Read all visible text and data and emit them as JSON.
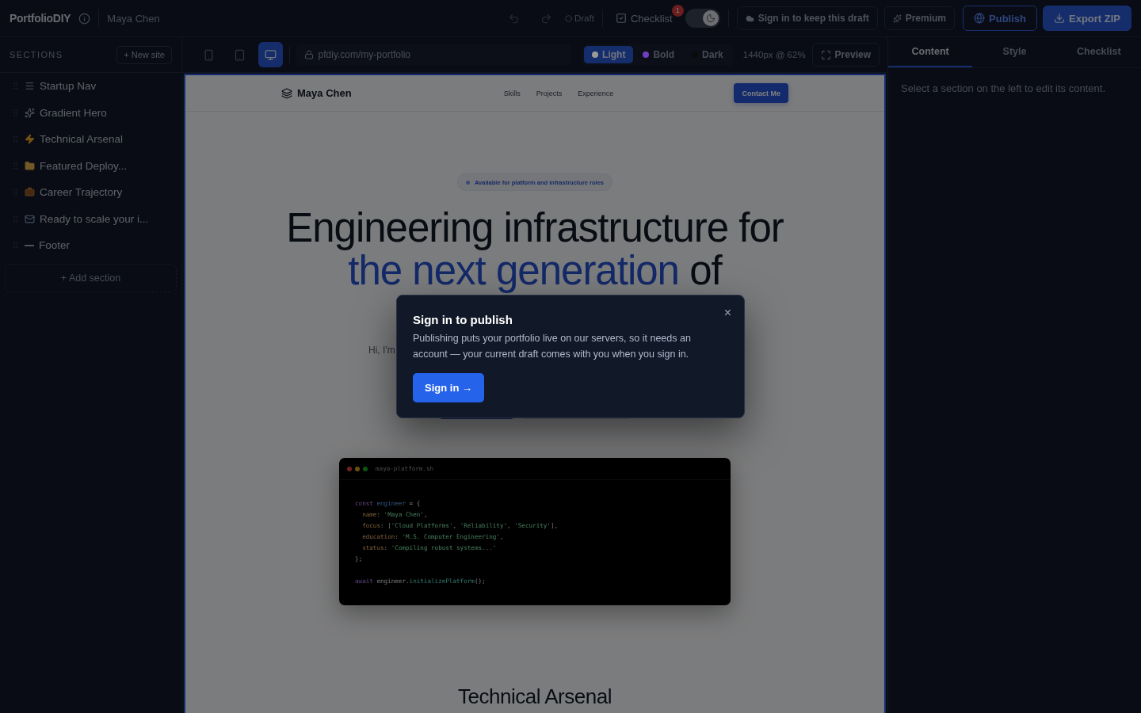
{
  "topbar": {
    "brand": "PortfolioDIY",
    "site_name": "Maya Chen",
    "draft": "Draft",
    "checklist": {
      "label": "Checklist",
      "badge": "1"
    },
    "dark_mode": {
      "on": true
    },
    "sign_in_prompt": "Sign in to keep this draft",
    "premium": "Premium",
    "publish": "Publish",
    "export": "Export ZIP"
  },
  "sidebar": {
    "heading": "SECTIONS",
    "new_site": "+ New site",
    "sections": [
      {
        "label": "Startup Nav",
        "kind": "menu"
      },
      {
        "label": "Gradient Hero",
        "kind": "sparkle"
      },
      {
        "label": "Technical Arsenal",
        "kind": "bolt"
      },
      {
        "label": "Featured Deploy...",
        "kind": "folder"
      },
      {
        "label": "Career Trajectory",
        "kind": "briefcase"
      },
      {
        "label": "Ready to scale your i...",
        "kind": "mail"
      },
      {
        "label": "Footer",
        "kind": "line"
      }
    ],
    "add_section": "+ Add section"
  },
  "canvas_toolbar": {
    "devices": [
      {
        "kind": "phone",
        "selected": false
      },
      {
        "kind": "tablet",
        "selected": false
      },
      {
        "kind": "desktop",
        "selected": true
      }
    ],
    "url": "pfdiy.com/my-portfolio",
    "themes": [
      {
        "label": "Light",
        "color": "#9a9a9a",
        "selected": true
      },
      {
        "label": "Bold",
        "color": "#6d3fc0",
        "selected": false
      },
      {
        "label": "Dark",
        "color": "#0b0b0b",
        "selected": false
      }
    ],
    "viewport": "1440px @ 62%",
    "preview": "Preview"
  },
  "preview": {
    "nav": {
      "brand": "Maya Chen",
      "links": [
        "Skills",
        "Projects",
        "Experience"
      ],
      "cta": "Contact Me"
    },
    "hero": {
      "badge": "Available for platform and infrastructure roles",
      "title_line": "Engineering infrastructure for",
      "title_highlight": "the next generation",
      "title_rest": "of",
      "intro": "Hi, I'm"
    },
    "code_window": {
      "filename": "maya-platform.sh",
      "lines": [
        [
          {
            "text": "const",
            "kind": "keyword"
          },
          {
            "text": " engineer",
            "kind": "var"
          },
          {
            "text": " = {",
            "kind": "punct"
          }
        ],
        [
          {
            "text": "  name",
            "kind": "prop"
          },
          {
            "text": ": ",
            "kind": "punct"
          },
          {
            "text": "'Maya Chen'",
            "kind": "string"
          },
          {
            "text": ",",
            "kind": "punct"
          }
        ],
        [
          {
            "text": "  focus",
            "kind": "prop"
          },
          {
            "text": ": [",
            "kind": "punct"
          },
          {
            "text": "'Cloud Platforms'",
            "kind": "string"
          },
          {
            "text": ", ",
            "kind": "punct"
          },
          {
            "text": "'Reliability'",
            "kind": "string"
          },
          {
            "text": ", ",
            "kind": "punct"
          },
          {
            "text": "'Security'",
            "kind": "string"
          },
          {
            "text": "],",
            "kind": "punct"
          }
        ],
        [
          {
            "text": "  education",
            "kind": "prop"
          },
          {
            "text": ": ",
            "kind": "punct"
          },
          {
            "text": "'M.S. Computer Engineering'",
            "kind": "string"
          },
          {
            "text": ",",
            "kind": "punct"
          }
        ],
        [
          {
            "text": "  status",
            "kind": "prop"
          },
          {
            "text": ": ",
            "kind": "punct"
          },
          {
            "text": "'Compiling robust systems...'",
            "kind": "string"
          }
        ],
        [
          {
            "text": "};",
            "kind": "punct"
          }
        ],
        {
          "gap_before": true,
          "tokens": [
            {
              "text": "await",
              "kind": "keyword"
            },
            {
              "text": " engineer.",
              "kind": "plain"
            },
            {
              "text": "initializePlatform",
              "kind": "func"
            },
            {
              "text": "();",
              "kind": "plain"
            }
          ]
        }
      ]
    },
    "next_section_title": "Technical Arsenal"
  },
  "right_panel": {
    "tabs": [
      {
        "label": "Content",
        "selected": true
      },
      {
        "label": "Style",
        "selected": false
      },
      {
        "label": "Checklist",
        "selected": false
      }
    ],
    "hint": "Select a section on the left to edit its content."
  },
  "modal": {
    "title": "Sign in to publish",
    "body": "Publishing puts your portfolio live on our servers, so it needs an account — your current draft comes with you when you sign in.",
    "button": "Sign in →",
    "close": "×"
  }
}
